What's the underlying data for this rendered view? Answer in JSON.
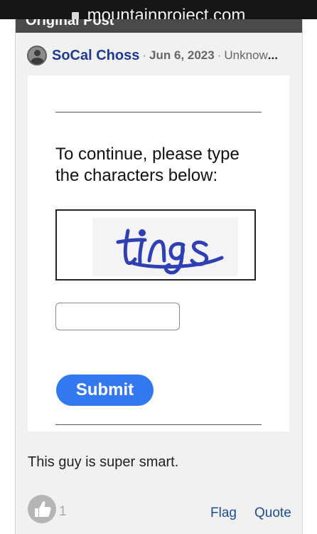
{
  "browser": {
    "url": "mountainproject.com",
    "lock_icon": "lock-icon"
  },
  "card": {
    "header_title": "Original Post"
  },
  "post": {
    "author": "SoCal Choss",
    "separator": "·",
    "date": "Jun 6, 2023",
    "location": "Unknow",
    "location_truncation": "...",
    "avatar_icon": "user-avatar-icon",
    "body": "This guy is super smart."
  },
  "captcha": {
    "prompt_line1": "To continue, please type",
    "prompt_line2": "the characters below:",
    "image_text": "tings",
    "input_value": "",
    "submit_label": "Submit"
  },
  "actions": {
    "like_icon": "thumbs-up-icon",
    "like_count": "1",
    "flag_label": "Flag",
    "quote_label": "Quote"
  },
  "colors": {
    "link": "#1f3a93",
    "submit": "#3478f0",
    "card_bg": "#f1f1f1",
    "header_bg": "#4a4a4a",
    "captcha_ink": "#2f3fb4"
  }
}
